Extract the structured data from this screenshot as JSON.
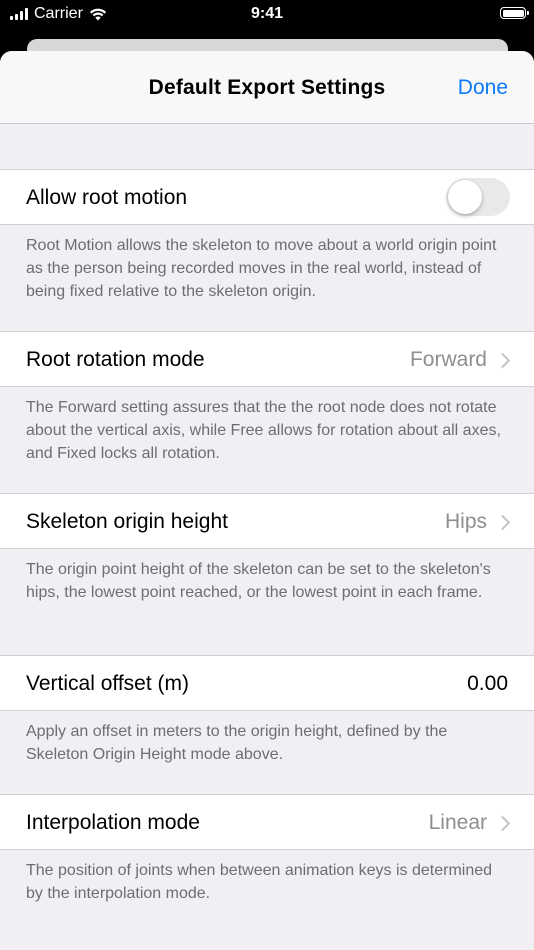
{
  "status_bar": {
    "carrier": "Carrier",
    "time": "9:41"
  },
  "nav": {
    "title": "Default Export Settings",
    "done": "Done"
  },
  "settings": [
    {
      "label": "Allow root motion",
      "type": "toggle",
      "on": false,
      "footer": "Root Motion allows the skeleton to move about a world origin point as the person being recorded moves in the real world, instead of being fixed relative to the skeleton origin."
    },
    {
      "label": "Root rotation mode",
      "type": "disclosure",
      "value": "Forward",
      "footer": "The Forward setting assures that the the root node does not rotate about the vertical axis, while Free allows for rotation about all axes, and Fixed locks all rotation."
    },
    {
      "label": "Skeleton origin height",
      "type": "disclosure",
      "value": "Hips",
      "footer": "The origin point height of the skeleton can be set to the skeleton's hips, the lowest point reached, or the lowest point in each frame."
    },
    {
      "label": "Vertical offset (m)",
      "type": "number",
      "value": "0.00",
      "footer": "Apply an offset in meters to the origin height, defined by the Skeleton Origin Height mode above."
    },
    {
      "label": "Interpolation mode",
      "type": "disclosure",
      "value": "Linear",
      "footer": "The position of joints when between animation keys is determined by the interpolation mode."
    }
  ],
  "colors": {
    "accent": "#0a7aff",
    "background": "#efeff4",
    "secondary_text": "#6d6d72"
  }
}
